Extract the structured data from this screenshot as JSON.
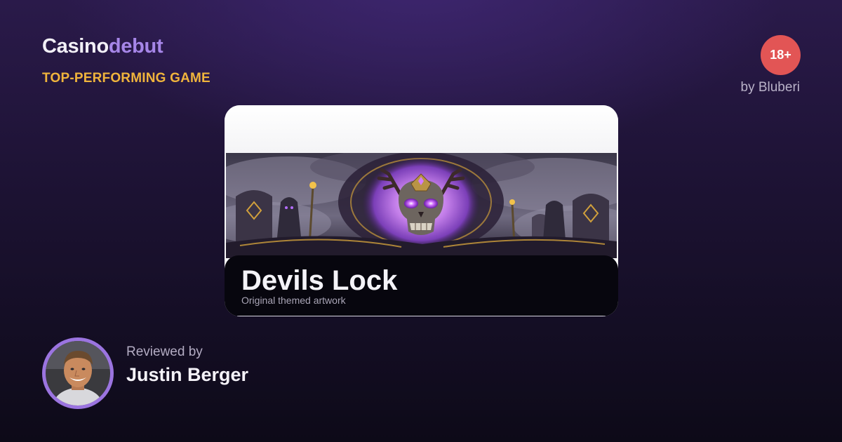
{
  "brand": {
    "name_part1": "Casino",
    "name_part2": "debut"
  },
  "category_label": "TOP-PERFORMING GAME",
  "age_badge": "18+",
  "provider": "by Bluberi",
  "game": {
    "title": "Devils Lock",
    "subtitle": "Original themed artwork",
    "artwork_icon": "skull-artwork"
  },
  "reviewer": {
    "label": "Reviewed by",
    "name": "Justin Berger",
    "avatar_icon": "reviewer-avatar"
  },
  "colors": {
    "brand_accent": "#a686e8",
    "category": "#f0b43c",
    "age_badge": "#e25555",
    "avatar_ring": "#9b74e0"
  }
}
